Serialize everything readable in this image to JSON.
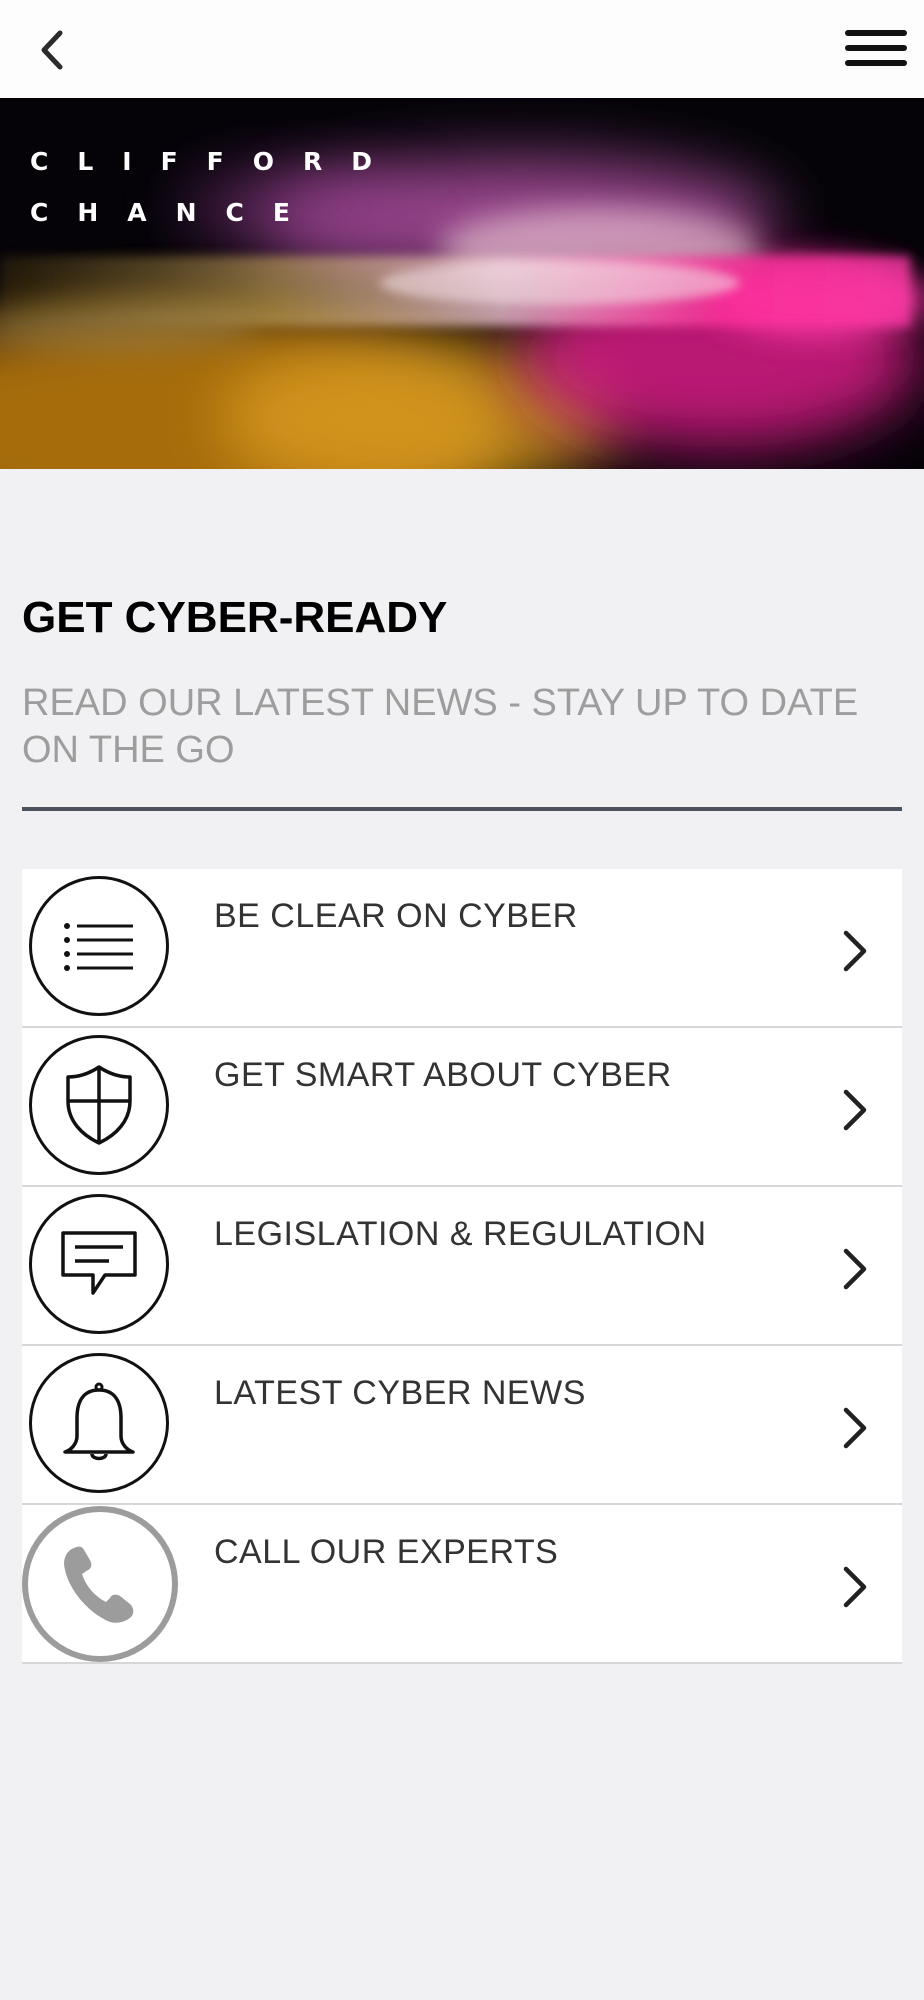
{
  "header": {
    "back_icon": "chevron-left-icon",
    "menu_icon": "hamburger-menu-icon"
  },
  "hero": {
    "logo_line1": "CLIFFORD",
    "logo_line2": "CHANCE"
  },
  "main": {
    "title": "GET CYBER-READY",
    "subtitle": "READ OUR LATEST NEWS - STAY UP TO DATE ON THE GO"
  },
  "menu": {
    "items": [
      {
        "label": "BE CLEAR ON CYBER",
        "icon": "list-icon"
      },
      {
        "label": "GET SMART ABOUT CYBER",
        "icon": "shield-icon"
      },
      {
        "label": "LEGISLATION & REGULATION",
        "icon": "message-icon"
      },
      {
        "label": "LATEST CYBER NEWS",
        "icon": "bell-icon"
      },
      {
        "label": "CALL OUR EXPERTS",
        "icon": "phone-icon"
      }
    ]
  },
  "colors": {
    "background": "#f1f1f3",
    "title": "#000000",
    "subtitle": "#9d9d9d",
    "divider": "#4d535c",
    "item_text": "#333333",
    "phone_circle": "#9c9c9c"
  }
}
